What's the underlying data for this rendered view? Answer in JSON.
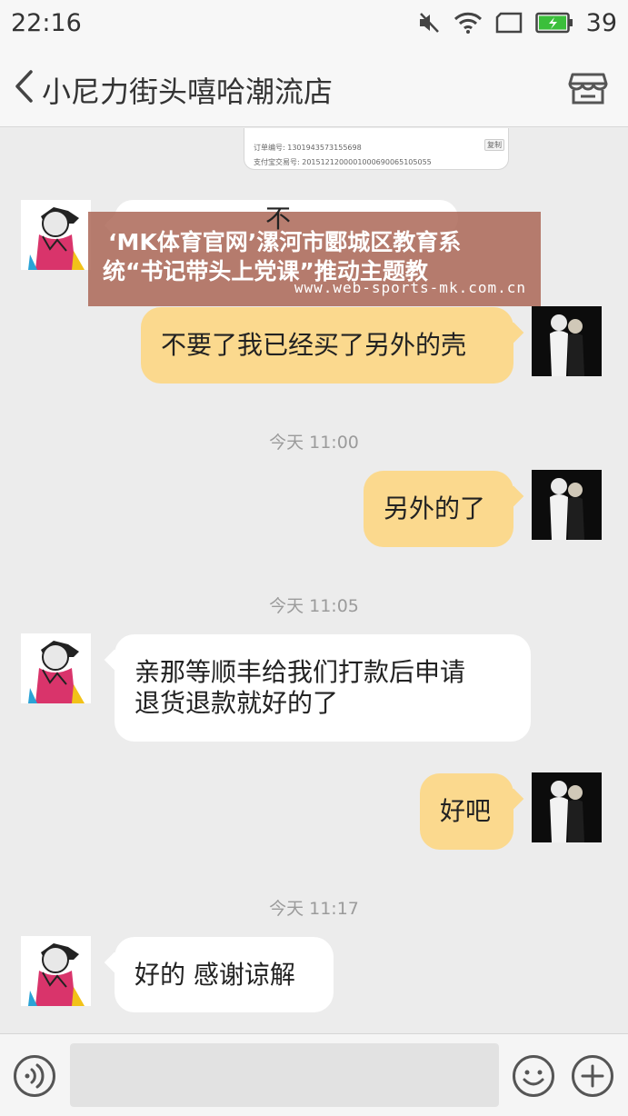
{
  "status_bar": {
    "time": "22:16",
    "battery_level": "39",
    "icons": [
      "mute-icon",
      "wifi-icon",
      "sim-icon",
      "battery-icon"
    ]
  },
  "header": {
    "title": "小尼力街头嘻哈潮流店",
    "back_icon": "chevron-left-icon",
    "store_icon": "store-icon"
  },
  "order_card": {
    "order_no": "订单编号: 1301943573155698",
    "alipay_no": "支付宝交易号: 2015121200001000690065105055",
    "copy_label": "复制"
  },
  "messages": [
    {
      "sender": "other",
      "text": "不",
      "partial": true
    },
    {
      "sender": "me",
      "text": "不要了我已经买了另外的壳"
    },
    {
      "type": "time",
      "text": "今天 11:00"
    },
    {
      "sender": "me",
      "text": "另外的了"
    },
    {
      "type": "time",
      "text": "今天 11:05"
    },
    {
      "sender": "other",
      "text": "亲那等顺丰给我们打款后申请\n退货退款就好的了"
    },
    {
      "sender": "me",
      "text": "好吧"
    },
    {
      "type": "time",
      "text": "今天 11:17"
    },
    {
      "sender": "other",
      "text": "好的  感谢谅解"
    }
  ],
  "watermark": {
    "line1": "‘MK体育官网’漯河市郾城区教育系",
    "line2": "统“书记带头上党课”推动主题教",
    "url": "www.web-sports-mk.com.cn"
  },
  "input_bar": {
    "value": "",
    "voice_icon": "voice-icon",
    "emoji_icon": "emoji-icon",
    "plus_icon": "plus-icon"
  },
  "colors": {
    "my_bubble": "#fbd98e",
    "other_bubble": "#ffffff",
    "background": "#ececec",
    "watermark": "#a86250"
  }
}
